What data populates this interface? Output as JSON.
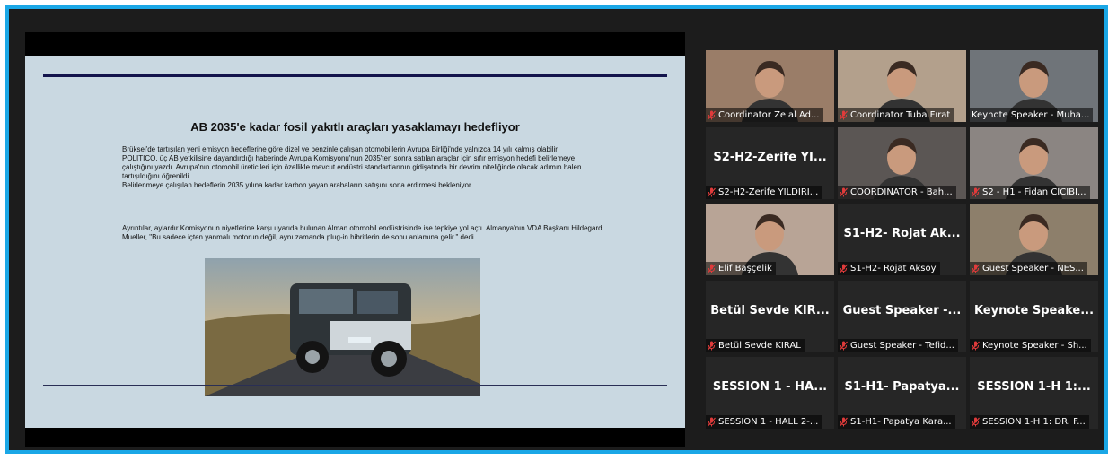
{
  "presentation": {
    "slide_title": "AB 2035'e kadar fosil yakıtlı araçları yasaklamayı hedefliyor",
    "paragraphs": [
      "Brüksel'de tartışılan yeni emisyon hedeflerine göre dizel ve benzinle çalışan otomobillerin Avrupa Birliği'nde yalnızca 14 yılı kalmış olabilir.",
      "POLITICO, üç AB yetkilisine dayandırdığı haberinde Avrupa Komisyonu'nun 2035'ten sonra satılan araçlar için sıfır emisyon hedefi belirlemeye çalıştığını yazdı. Avrupa'nın otomobil üreticileri için özellikle mevcut endüstri standartlarının gidişatında bir devrim niteliğinde olacak adımın halen tartışıldığını öğrenildi.",
      "Belirlenmeye çalışılan hedeflerin 2035 yılına kadar karbon yayan arabaların satışını sona erdirmesi bekleniyor.",
      "Ayrıntılar, aylardır Komisyonun niyetlerine karşı uyarıda bulunan Alman otomobil endüstrisinde ise tepkiye yol açtı. Almanya'nın VDA Başkanı Hildegard Mueller, \"Bu sadece içten yanmalı motorun değil, aynı zamanda plug-in hibritlerin de sonu anlamına gelir.\" dedi."
    ],
    "image_icon": "car-photo"
  },
  "participants": [
    {
      "name": "Coordinator Zelal Ad...",
      "video": true,
      "muted": true,
      "active": false
    },
    {
      "name": "Coordinator Tuba Fırat",
      "video": true,
      "muted": true,
      "active": false
    },
    {
      "name": "Keynote Speaker - Muha...",
      "video": true,
      "muted": false,
      "active": true
    },
    {
      "name": "S2-H2-Zerife YILDIRI...",
      "display": "S2-H2-Zerife  YI...",
      "video": false,
      "muted": true,
      "active": false
    },
    {
      "name": "COORDINATOR - Bah...",
      "video": true,
      "muted": true,
      "active": false
    },
    {
      "name": "S2 - H1 - Fidan CİCİBI...",
      "video": true,
      "muted": true,
      "active": false
    },
    {
      "name": "Elif Başçelik",
      "video": true,
      "muted": true,
      "active": false
    },
    {
      "name": "S1-H2- Rojat Aksoy",
      "display": "S1-H2- Rojat Ak...",
      "video": false,
      "muted": true,
      "active": false
    },
    {
      "name": "Guest Speaker - NES...",
      "video": true,
      "muted": true,
      "active": false
    },
    {
      "name": "Betül Sevde KIRAL",
      "display": "Betül Sevde KIR...",
      "video": false,
      "muted": true,
      "active": false
    },
    {
      "name": "Guest Speaker - Tefid...",
      "display": "Guest Speaker -...",
      "video": false,
      "muted": true,
      "active": false
    },
    {
      "name": "Keynote Speaker - Sh...",
      "display": "Keynote  Speake...",
      "video": false,
      "muted": true,
      "active": false
    },
    {
      "name": "SESSION 1 - HALL 2-...",
      "display": "SESSION 1 - HA...",
      "video": false,
      "muted": true,
      "active": false
    },
    {
      "name": "S1-H1- Papatya Kara...",
      "display": "S1-H1-  Papatya...",
      "video": false,
      "muted": true,
      "active": false
    },
    {
      "name": "SESSION 1-H 1: DR. F...",
      "display": "SESSION 1-H 1:...",
      "video": false,
      "muted": true,
      "active": false
    }
  ],
  "colors": {
    "frame": "#1aa7e6",
    "active_speaker": "#d6e34b",
    "muted_mic": "#e03b3b",
    "slide_bg": "#c9d8e1"
  }
}
